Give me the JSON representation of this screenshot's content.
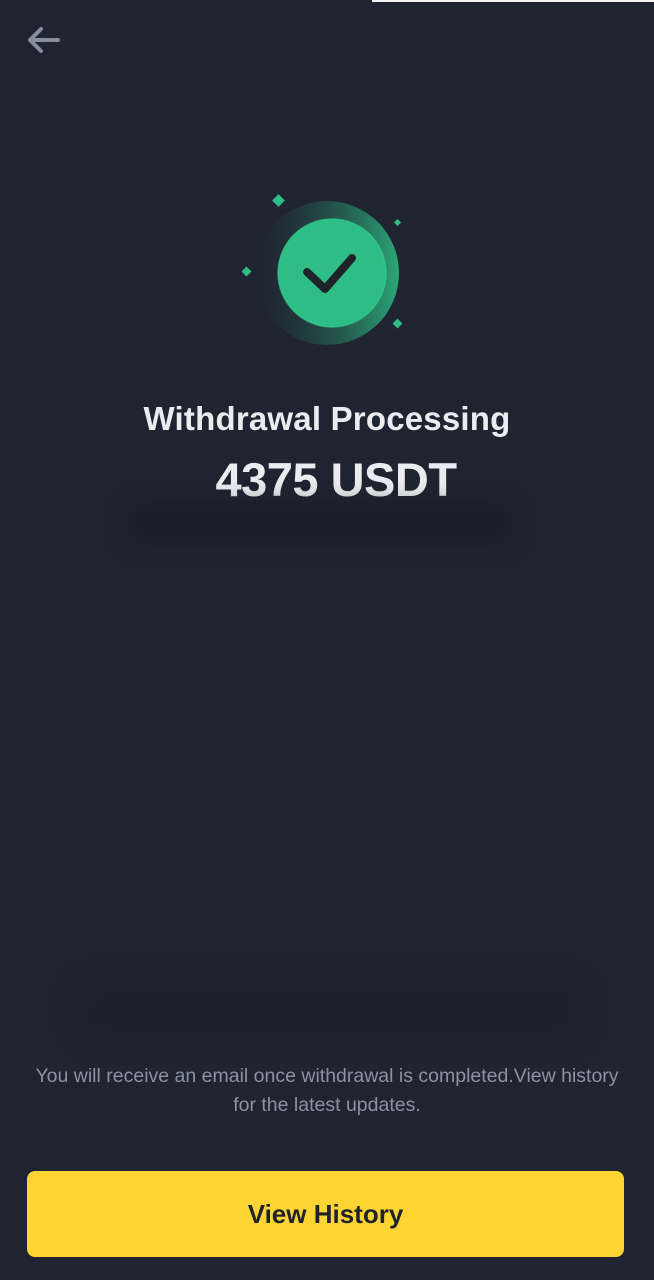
{
  "header": {
    "back_icon": "arrow-left-icon"
  },
  "status": {
    "icon": "check-circle-icon",
    "title": "Withdrawal Processing",
    "amount": "4375 USDT"
  },
  "notice": {
    "text": "You will receive an email once withdrawal is completed.View history for the latest updates."
  },
  "footer": {
    "view_history_label": "View History"
  },
  "colors": {
    "background": "#1f2430",
    "accent_green": "#2ebd85",
    "button_yellow": "#fcd535",
    "title_text": "#eaecef",
    "muted_text": "#8b92a0",
    "back_icon": "#848e9c"
  }
}
